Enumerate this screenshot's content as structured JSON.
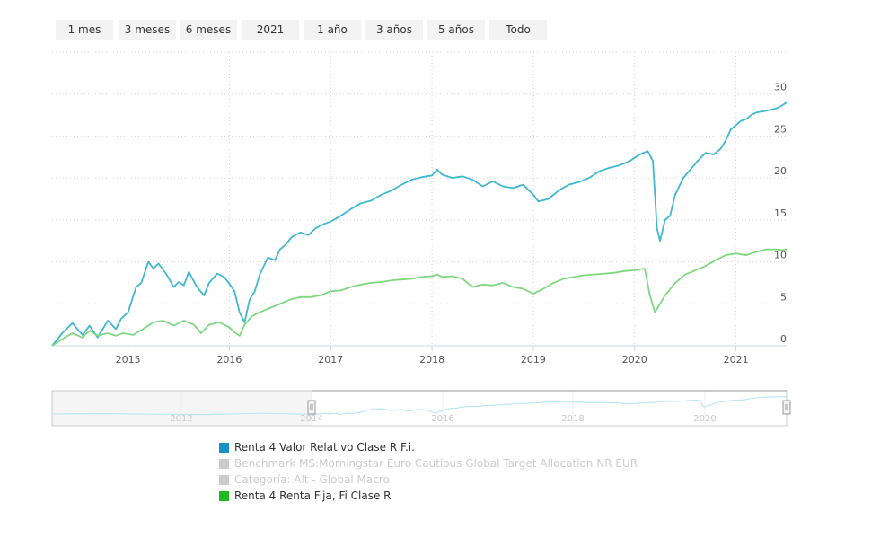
{
  "range_buttons": [
    "1 mes",
    "3 meses",
    "6 meses",
    "2021",
    "1 año",
    "3 años",
    "5 años",
    "Todo"
  ],
  "chart_data": {
    "type": "line",
    "y_ticks": [
      0,
      5,
      10,
      15,
      20,
      25,
      30
    ],
    "x_ticks": [
      "2015",
      "2016",
      "2017",
      "2018",
      "2019",
      "2020",
      "2021"
    ],
    "x_range": [
      2014.25,
      2021.5
    ],
    "y_range": [
      0,
      35
    ],
    "grid": true,
    "legend_placement": "bottom",
    "series": [
      {
        "name": "Renta 4 Valor Relativo Clase R F.i.",
        "color": "#3fb8d0",
        "visible": true,
        "x": [
          2014.25,
          2014.35,
          2014.45,
          2014.55,
          2014.62,
          2014.7,
          2014.8,
          2014.88,
          2014.93,
          2015.0,
          2015.08,
          2015.13,
          2015.2,
          2015.25,
          2015.3,
          2015.38,
          2015.45,
          2015.5,
          2015.55,
          2015.6,
          2015.68,
          2015.75,
          2015.8,
          2015.88,
          2015.95,
          2016.0,
          2016.05,
          2016.08,
          2016.1,
          2016.15,
          2016.2,
          2016.25,
          2016.3,
          2016.38,
          2016.45,
          2016.5,
          2016.55,
          2016.62,
          2016.7,
          2016.78,
          2016.85,
          2016.93,
          2017.0,
          2017.1,
          2017.2,
          2017.3,
          2017.4,
          2017.5,
          2017.6,
          2017.7,
          2017.8,
          2017.9,
          2018.0,
          2018.05,
          2018.1,
          2018.2,
          2018.3,
          2018.4,
          2018.5,
          2018.6,
          2018.7,
          2018.8,
          2018.9,
          2019.0,
          2019.05,
          2019.15,
          2019.25,
          2019.35,
          2019.45,
          2019.55,
          2019.65,
          2019.75,
          2019.85,
          2019.95,
          2020.05,
          2020.13,
          2020.18,
          2020.22,
          2020.25,
          2020.3,
          2020.35,
          2020.4,
          2020.48,
          2020.55,
          2020.62,
          2020.7,
          2020.78,
          2020.85,
          2020.9,
          2020.95,
          2021.0,
          2021.05,
          2021.1,
          2021.15,
          2021.2,
          2021.3,
          2021.4,
          2021.45,
          2021.5
        ],
        "y": [
          0,
          1.5,
          2.7,
          1.3,
          2.4,
          1.0,
          3.0,
          2.0,
          3.2,
          4.0,
          7.0,
          7.5,
          10.0,
          9.2,
          9.8,
          8.5,
          7.0,
          7.6,
          7.2,
          8.8,
          7.0,
          6.0,
          7.5,
          8.6,
          8.2,
          7.4,
          6.5,
          5.0,
          4.0,
          2.8,
          5.5,
          6.5,
          8.5,
          10.5,
          10.2,
          11.5,
          12.0,
          13.0,
          13.5,
          13.2,
          14.0,
          14.5,
          14.8,
          15.5,
          16.3,
          17.0,
          17.3,
          18.0,
          18.5,
          19.2,
          19.8,
          20.1,
          20.3,
          21.0,
          20.4,
          20.0,
          20.2,
          19.8,
          19.0,
          19.6,
          19.0,
          18.8,
          19.2,
          18.0,
          17.2,
          17.5,
          18.5,
          19.2,
          19.5,
          20.0,
          20.8,
          21.2,
          21.5,
          22.0,
          22.8,
          23.2,
          22.0,
          14.0,
          12.5,
          15.0,
          15.5,
          18.0,
          20.0,
          21.0,
          22.0,
          23.0,
          22.8,
          23.5,
          24.5,
          25.8,
          26.3,
          26.8,
          27.0,
          27.5,
          27.8,
          28.0,
          28.3,
          28.6,
          29.0
        ]
      },
      {
        "name": "Benchmark MS:Morningstar Euro Cautious Global Target Allocation NR EUR",
        "color": "#cccccc",
        "visible": false
      },
      {
        "name": "Categoría: Alt - Global Macro",
        "color": "#cccccc",
        "visible": false
      },
      {
        "name": "Renta 4 Renta Fija, Fi Clase R",
        "color": "#7fd87f",
        "visible": true,
        "x": [
          2014.25,
          2014.35,
          2014.45,
          2014.55,
          2014.62,
          2014.7,
          2014.8,
          2014.88,
          2014.95,
          2015.05,
          2015.15,
          2015.25,
          2015.35,
          2015.45,
          2015.55,
          2015.65,
          2015.72,
          2015.8,
          2015.9,
          2016.0,
          2016.05,
          2016.1,
          2016.15,
          2016.22,
          2016.3,
          2016.4,
          2016.5,
          2016.6,
          2016.7,
          2016.8,
          2016.9,
          2017.0,
          2017.1,
          2017.2,
          2017.3,
          2017.4,
          2017.5,
          2017.6,
          2017.7,
          2017.8,
          2017.9,
          2018.0,
          2018.05,
          2018.1,
          2018.2,
          2018.3,
          2018.4,
          2018.5,
          2018.6,
          2018.7,
          2018.8,
          2018.9,
          2019.0,
          2019.1,
          2019.2,
          2019.3,
          2019.4,
          2019.5,
          2019.6,
          2019.7,
          2019.8,
          2019.9,
          2020.0,
          2020.1,
          2020.15,
          2020.2,
          2020.25,
          2020.3,
          2020.4,
          2020.5,
          2020.6,
          2020.7,
          2020.8,
          2020.9,
          2021.0,
          2021.1,
          2021.2,
          2021.3,
          2021.4,
          2021.45,
          2021.5
        ],
        "y": [
          0,
          0.8,
          1.5,
          1.0,
          1.8,
          1.2,
          1.5,
          1.2,
          1.5,
          1.3,
          2.0,
          2.8,
          3.0,
          2.4,
          3.0,
          2.5,
          1.5,
          2.5,
          2.8,
          2.2,
          1.6,
          1.2,
          2.5,
          3.5,
          4.0,
          4.5,
          5.0,
          5.5,
          5.8,
          5.8,
          6.0,
          6.5,
          6.6,
          7.0,
          7.3,
          7.5,
          7.6,
          7.8,
          7.9,
          8.0,
          8.2,
          8.3,
          8.5,
          8.2,
          8.3,
          8.0,
          7.0,
          7.3,
          7.2,
          7.5,
          7.0,
          6.8,
          6.2,
          6.8,
          7.5,
          8.0,
          8.2,
          8.4,
          8.5,
          8.6,
          8.7,
          8.9,
          9.0,
          9.2,
          6.0,
          4.0,
          5.0,
          6.0,
          7.5,
          8.5,
          9.0,
          9.5,
          10.2,
          10.8,
          11.0,
          10.8,
          11.2,
          11.5,
          11.5,
          11.4,
          11.5
        ]
      }
    ],
    "navigator": {
      "x_ticks": [
        "2012",
        "2014",
        "2016",
        "2018",
        "2020"
      ]
    }
  }
}
